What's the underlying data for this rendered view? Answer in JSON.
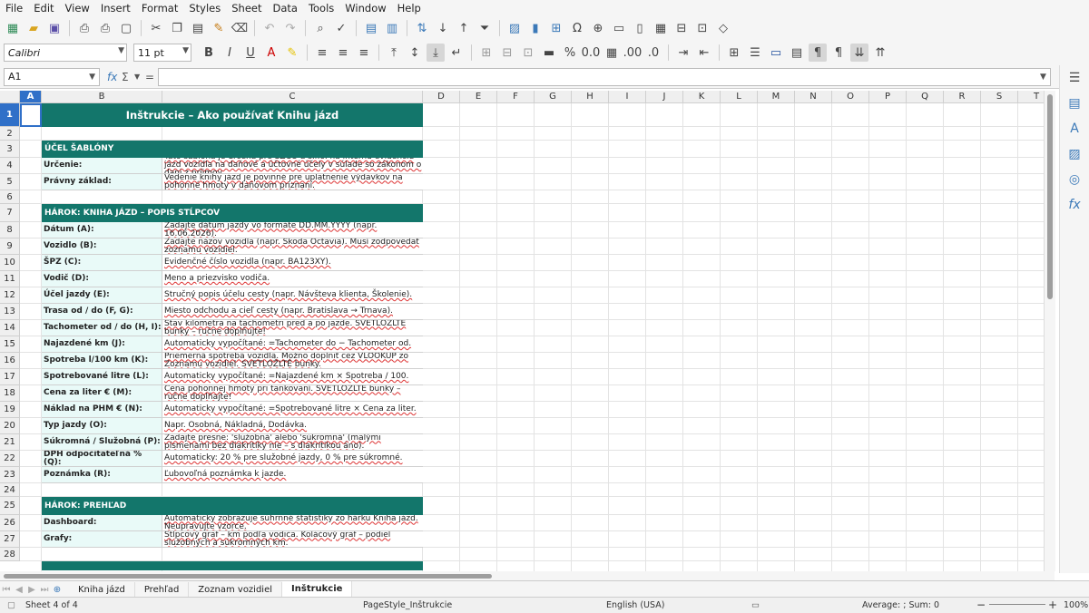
{
  "menu": [
    "File",
    "Edit",
    "View",
    "Insert",
    "Format",
    "Styles",
    "Sheet",
    "Data",
    "Tools",
    "Window",
    "Help"
  ],
  "format_bar": {
    "font_name": "Calibri",
    "font_size": "11 pt"
  },
  "formula_bar": {
    "cell_ref": "A1",
    "fx": "fx",
    "sum": "Σ",
    "equals": "=",
    "value": ""
  },
  "columns": [
    "A",
    "B",
    "C",
    "D",
    "E",
    "F",
    "G",
    "H",
    "I",
    "J",
    "K",
    "L",
    "M",
    "N",
    "O",
    "P",
    "Q",
    "R",
    "S",
    "T"
  ],
  "rows": [
    "1",
    "2",
    "3",
    "4",
    "5",
    "6",
    "7",
    "8",
    "9",
    "10",
    "11",
    "12",
    "13",
    "14",
    "15",
    "16",
    "17",
    "18",
    "19",
    "20",
    "21",
    "22",
    "23",
    "24",
    "25",
    "26",
    "27",
    "28"
  ],
  "sheet": {
    "title": "Inštrukcie – Ako používať Knihu jázd",
    "section1": "ÚČEL ŠABLÓNY",
    "s1_rows": [
      {
        "label": "Určenie:",
        "text": "Táto šablóna je určená pre SZČO a s.r.o. na internú evidenciu jázd vozidla na daňové a účtovné účely v súlade so zákonom o dani z príjmov."
      },
      {
        "label": "Právny základ:",
        "text": "Vedenie knihy jázd je povinné pre uplatnenie výdavkov na pohonné hmoty v daňovom priznaní."
      }
    ],
    "section2": "HÁROK: KNIHA JÁZD – POPIS STĹPCOV",
    "s2_rows": [
      {
        "label": "Dátum (A):",
        "text": "Zadajte dátum jazdy vo formáte DD.MM.YYYY (napr. 16.06.2026)."
      },
      {
        "label": "Vozidlo (B):",
        "text": "Zadajte názov vozidla (napr. Škoda Octavia). Musí zodpovedať zoznamu vozidiel."
      },
      {
        "label": "ŠPZ (C):",
        "text": "Evidenčné číslo vozidla (napr. BA123XY)."
      },
      {
        "label": "Vodič (D):",
        "text": "Meno a priezvisko vodiča."
      },
      {
        "label": "Účel jazdy (E):",
        "text": "Stručný popis účelu cesty (napr. Návšteva klienta, Školenie)."
      },
      {
        "label": "Trasa od / do (F, G):",
        "text": "Miesto odchodu a cieľ cesty (napr. Bratislava → Trnava)."
      },
      {
        "label": "Tachometer od / do (H, I):",
        "text": "Stav kilometra na tachometri pred a po jazde. SVETLOŽLTÉ bunky – ručne doplňujte!"
      },
      {
        "label": "Najazdené km (J):",
        "text": "Automaticky vypočítané: =Tachometer do − Tachometer od."
      },
      {
        "label": "Spotreba l/100 km (K):",
        "text": "Priemerná spotreba vozidla. Možno doplniť cez VLOOKUP zo Zoznamu vozidiel. SVETLOŽLTÉ bunky."
      },
      {
        "label": "Spotrebované litre (L):",
        "text": "Automaticky vypočítané: =Najazdené km × Spotreba / 100."
      },
      {
        "label": "Cena za liter € (M):",
        "text": "Cena pohonnej hmoty pri tankovaní. SVETLOŽLTÉ bunky – ručne doplňajte!"
      },
      {
        "label": "Náklad na PHM € (N):",
        "text": "Automaticky vypočítané: =Spotrebované litre × Cena za liter."
      },
      {
        "label": "Typ jazdy (O):",
        "text": "Napr. Osobná, Nákladná, Dodávka."
      },
      {
        "label": "Súkromná / Služobná (P):",
        "text": "Zadajte presne: 'služobná' alebo 'súkromná' (malými písmenami bez diakritiky nie – s diakritikou áno)."
      },
      {
        "label": "DPH odpočítateľná % (Q):",
        "text": "Automaticky: 20 % pre služobné jazdy, 0 % pre súkromné."
      },
      {
        "label": "Poznámka (R):",
        "text": "Ľubovoľná poznámka k jazde."
      }
    ],
    "section3": "HÁROK: PREHĽAD",
    "s3_rows": [
      {
        "label": "Dashboard:",
        "text": "Automaticky zobrazuje súhrnné štatistiky zo hárku Kniha jázd. Neupravujte vzorce."
      },
      {
        "label": "Grafy:",
        "text": "Stĺpcový graf – km podľa vodiča. Koláčový graf – podiel služobných a súkromných km."
      }
    ]
  },
  "tabs": [
    "Kniha jázd",
    "Prehľad",
    "Zoznam vozidiel",
    "Inštrukcie"
  ],
  "status": {
    "sheet": "Sheet 4 of 4",
    "page_style": "PageStyle_Inštrukcie",
    "language": "English (USA)",
    "summary": "Average: ; Sum: 0",
    "zoom": "100%"
  },
  "colors": {
    "teal": "#13766b",
    "label_bg": "#e9faf8",
    "selection": "#3070c8"
  }
}
